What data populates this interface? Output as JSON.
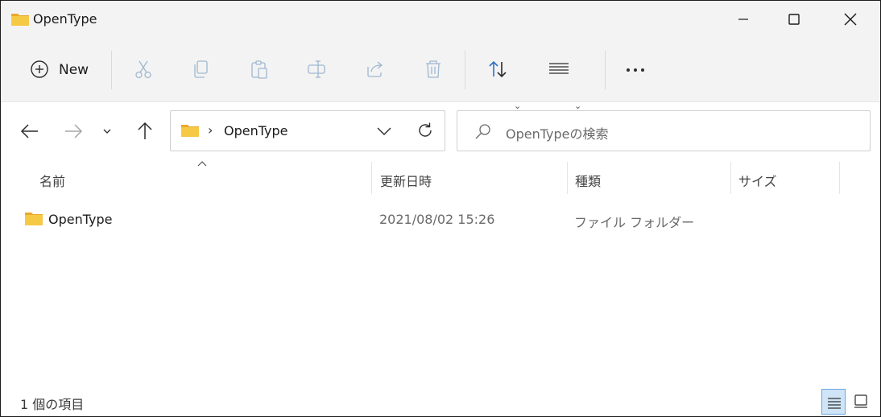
{
  "window": {
    "title": "OpenType",
    "controls": {
      "minimize": "minimize",
      "maximize": "maximize",
      "close": "close"
    }
  },
  "command_bar": {
    "new_label": "New",
    "icons": [
      "cut-icon",
      "copy-icon",
      "paste-icon",
      "rename-icon",
      "share-icon",
      "delete-icon",
      "sort-icon",
      "view-icon",
      "more-icon"
    ]
  },
  "address": {
    "crumb": "OpenType"
  },
  "search": {
    "placeholder": "OpenTypeの検索"
  },
  "columns": {
    "name": "名前",
    "date": "更新日時",
    "type": "種類",
    "size": "サイズ"
  },
  "files": [
    {
      "name": "OpenType",
      "modified": "2021/08/02 15:26",
      "type": "ファイル フォルダー",
      "size": ""
    }
  ],
  "status": {
    "item_count": "1 個の項目"
  },
  "colors": {
    "folder_yellow": "#f6c945",
    "accent_blue": "#2f6fc4",
    "selected_view_bg": "#cfe4f7"
  }
}
